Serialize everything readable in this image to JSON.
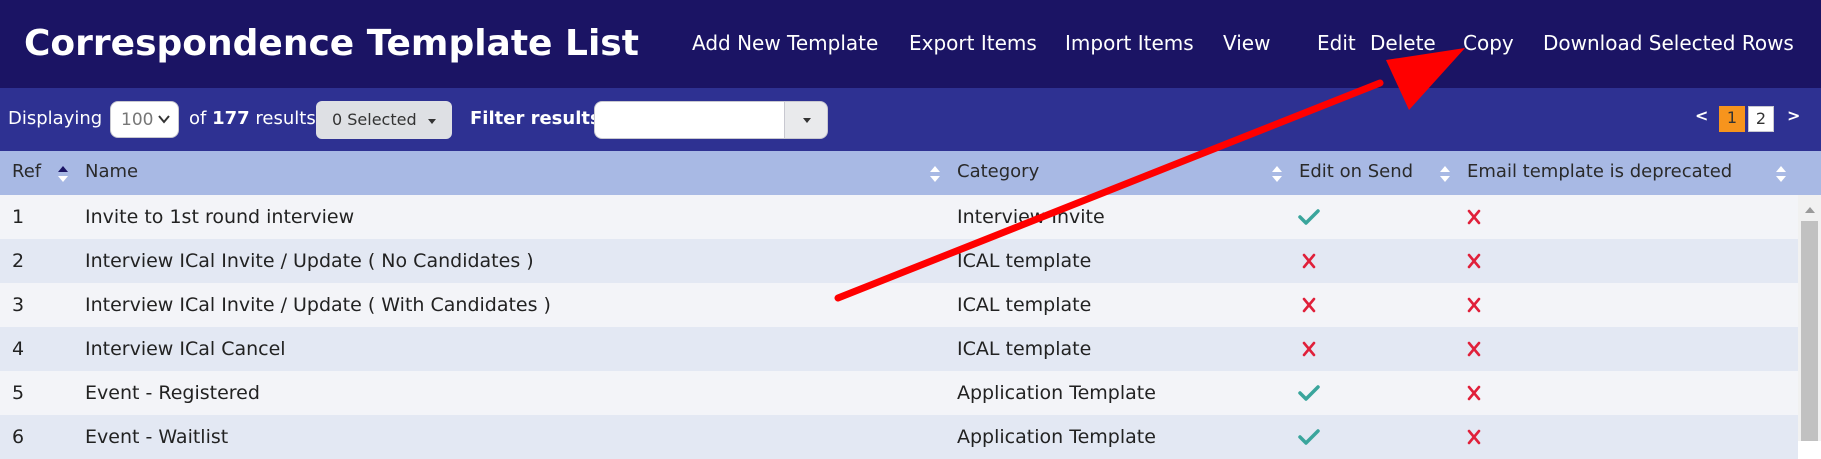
{
  "header": {
    "title": "Correspondence Template List",
    "nav": [
      "Add New Template",
      "Export Items",
      "Import Items",
      "View",
      "Edit",
      "Delete",
      "Copy",
      "Download Selected Rows"
    ]
  },
  "toolbar": {
    "displaying_label": "Displaying",
    "page_size": "100",
    "of_label": "of",
    "total": "177",
    "results_label": "results",
    "selected_label": "0 Selected",
    "filter_label": "Filter results",
    "filter_value": "",
    "pages": [
      "1",
      "2"
    ],
    "current_page": "1",
    "prev": "<",
    "next": ">"
  },
  "table": {
    "columns": [
      "Ref",
      "Name",
      "Category",
      "Edit on Send",
      "Email template is deprecated"
    ],
    "sort_column": "Ref",
    "rows": [
      {
        "ref": "1",
        "name": "Invite to 1st round interview",
        "category": "Interview Invite",
        "edit_on_send": "check-icon",
        "deprecated": "cross-icon"
      },
      {
        "ref": "2",
        "name": "Interview ICal Invite / Update ( No Candidates )",
        "category": "ICAL template",
        "edit_on_send": "cross-icon",
        "deprecated": "cross-icon"
      },
      {
        "ref": "3",
        "name": "Interview ICal Invite / Update ( With Candidates )",
        "category": "ICAL template",
        "edit_on_send": "cross-icon",
        "deprecated": "cross-icon"
      },
      {
        "ref": "4",
        "name": "Interview ICal Cancel",
        "category": "ICAL template",
        "edit_on_send": "cross-icon",
        "deprecated": "cross-icon"
      },
      {
        "ref": "5",
        "name": "Event - Registered",
        "category": "Application Template",
        "edit_on_send": "check-icon",
        "deprecated": "cross-icon"
      },
      {
        "ref": "6",
        "name": "Event - Waitlist",
        "category": "Application Template",
        "edit_on_send": "check-icon",
        "deprecated": "cross-icon"
      }
    ]
  },
  "colors": {
    "header_bg": "#1b1464",
    "toolbar_bg": "#2e3192",
    "table_header_bg": "#a8b9e4",
    "row_odd": "#f3f4f8",
    "row_even": "#e3e8f3",
    "check": "#3aa59c",
    "cross": "#e0203a",
    "annotation_arrow": "#ff0000",
    "active_page": "#f7941d"
  }
}
